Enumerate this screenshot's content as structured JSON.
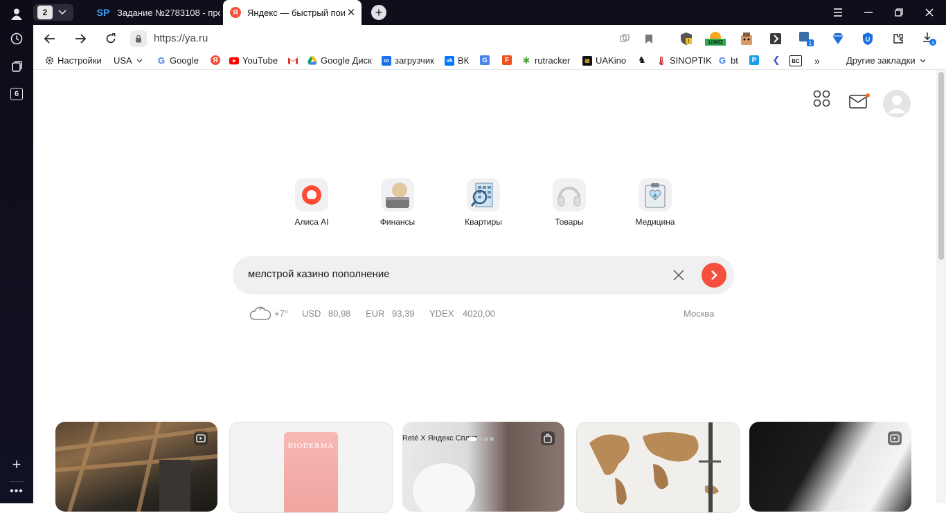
{
  "leftbar": {
    "tab_count_badge": "6"
  },
  "tabbar": {
    "group_count": "2",
    "tabs": [
      {
        "favicon_text": "SP",
        "title": "Задание №2783108 - прос",
        "active": false
      },
      {
        "favicon_text": "Я",
        "title": "Яндекс — быстрый пои",
        "active": true
      }
    ]
  },
  "address": {
    "url": "https://ya.ru",
    "extension_badge_count": "10982",
    "notification_badge": "1",
    "download_badge": "4"
  },
  "bookmarks": [
    {
      "label": "Настройки",
      "icon": "gear-icon"
    },
    {
      "label": "USA",
      "icon": "none",
      "dropdown": true
    },
    {
      "label": "Google",
      "icon": "google-icon"
    },
    {
      "label": "",
      "icon": "yandex-icon"
    },
    {
      "label": "YouTube",
      "icon": "youtube-icon"
    },
    {
      "label": "",
      "icon": "gmail-icon"
    },
    {
      "label": "Google Диск",
      "icon": "google-drive-icon"
    },
    {
      "label": "загрузчик",
      "icon": "loop-icon"
    },
    {
      "label": "ВК",
      "icon": "vk-icon"
    },
    {
      "label": "",
      "icon": "translate-icon"
    },
    {
      "label": "",
      "icon": "f-icon"
    },
    {
      "label": "rutracker",
      "icon": "rutracker-icon"
    },
    {
      "label": "UAKino",
      "icon": "uakino-icon"
    },
    {
      "label": "",
      "icon": "chess-icon"
    },
    {
      "label": "SINOPTIK",
      "icon": "thermometer-icon"
    },
    {
      "label": "bt",
      "icon": "google-icon"
    },
    {
      "label": "",
      "icon": "p-icon"
    },
    {
      "label": "",
      "icon": "arrow-icon"
    },
    {
      "label": "BC",
      "icon": "bc-icon"
    },
    {
      "label": "»",
      "icon": "none"
    }
  ],
  "other_bookmarks": "Другие закладки",
  "services": [
    {
      "label": "Алиса AI",
      "icon": "alice-icon"
    },
    {
      "label": "Финансы",
      "icon": "finance-icon"
    },
    {
      "label": "Квартиры",
      "icon": "apartments-icon"
    },
    {
      "label": "Товары",
      "icon": "headphones-icon"
    },
    {
      "label": "Медицина",
      "icon": "medicine-icon"
    }
  ],
  "search": {
    "query": "мелстрой казино пополнение"
  },
  "info": {
    "weather": "+7°",
    "usd_label": "USD",
    "usd_value": "80,98",
    "eur_label": "EUR",
    "eur_value": "93,39",
    "ydex_label": "YDEX",
    "ydex_value": "4020,00",
    "city": "Москва"
  },
  "cards": [
    {
      "kind": "video",
      "caption": ""
    },
    {
      "kind": "product",
      "caption": "BIODERMA"
    },
    {
      "kind": "shop",
      "caption": "Reté X Яндекс Сплит"
    },
    {
      "kind": "image",
      "caption": ""
    },
    {
      "kind": "video",
      "caption": ""
    }
  ],
  "colors": {
    "accent": "#f5503c",
    "tabbar": "#0f0f1c",
    "search_bg": "#f0f0f0"
  }
}
